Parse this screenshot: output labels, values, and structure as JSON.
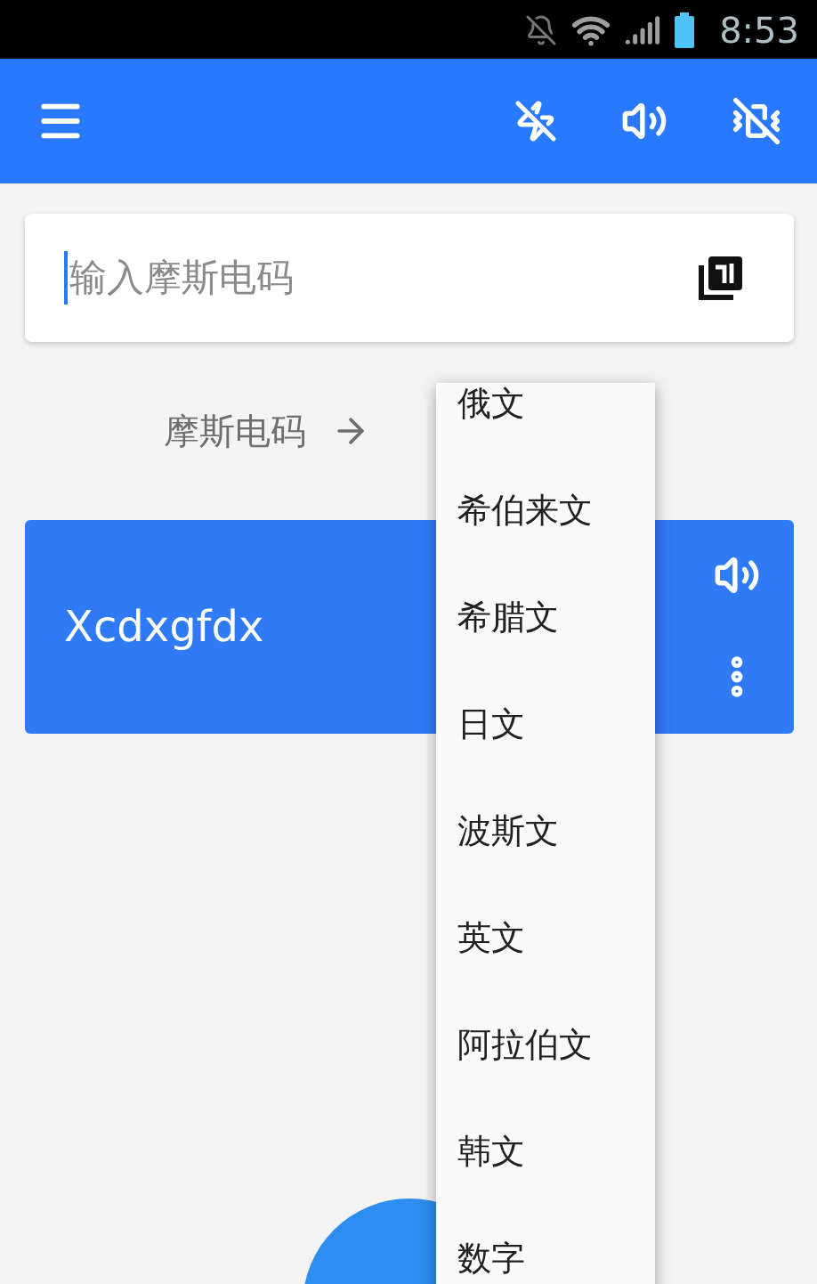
{
  "status_bar": {
    "time": "8:53"
  },
  "input": {
    "placeholder": "输入摩斯电码"
  },
  "direction": {
    "source": "摩斯电码"
  },
  "output_card": {
    "text": "Xcdxgfdx"
  },
  "language_menu": {
    "items": [
      "俄文",
      "希伯来文",
      "希腊文",
      "日文",
      "波斯文",
      "英文",
      "阿拉伯文",
      "韩文",
      "数字"
    ]
  }
}
